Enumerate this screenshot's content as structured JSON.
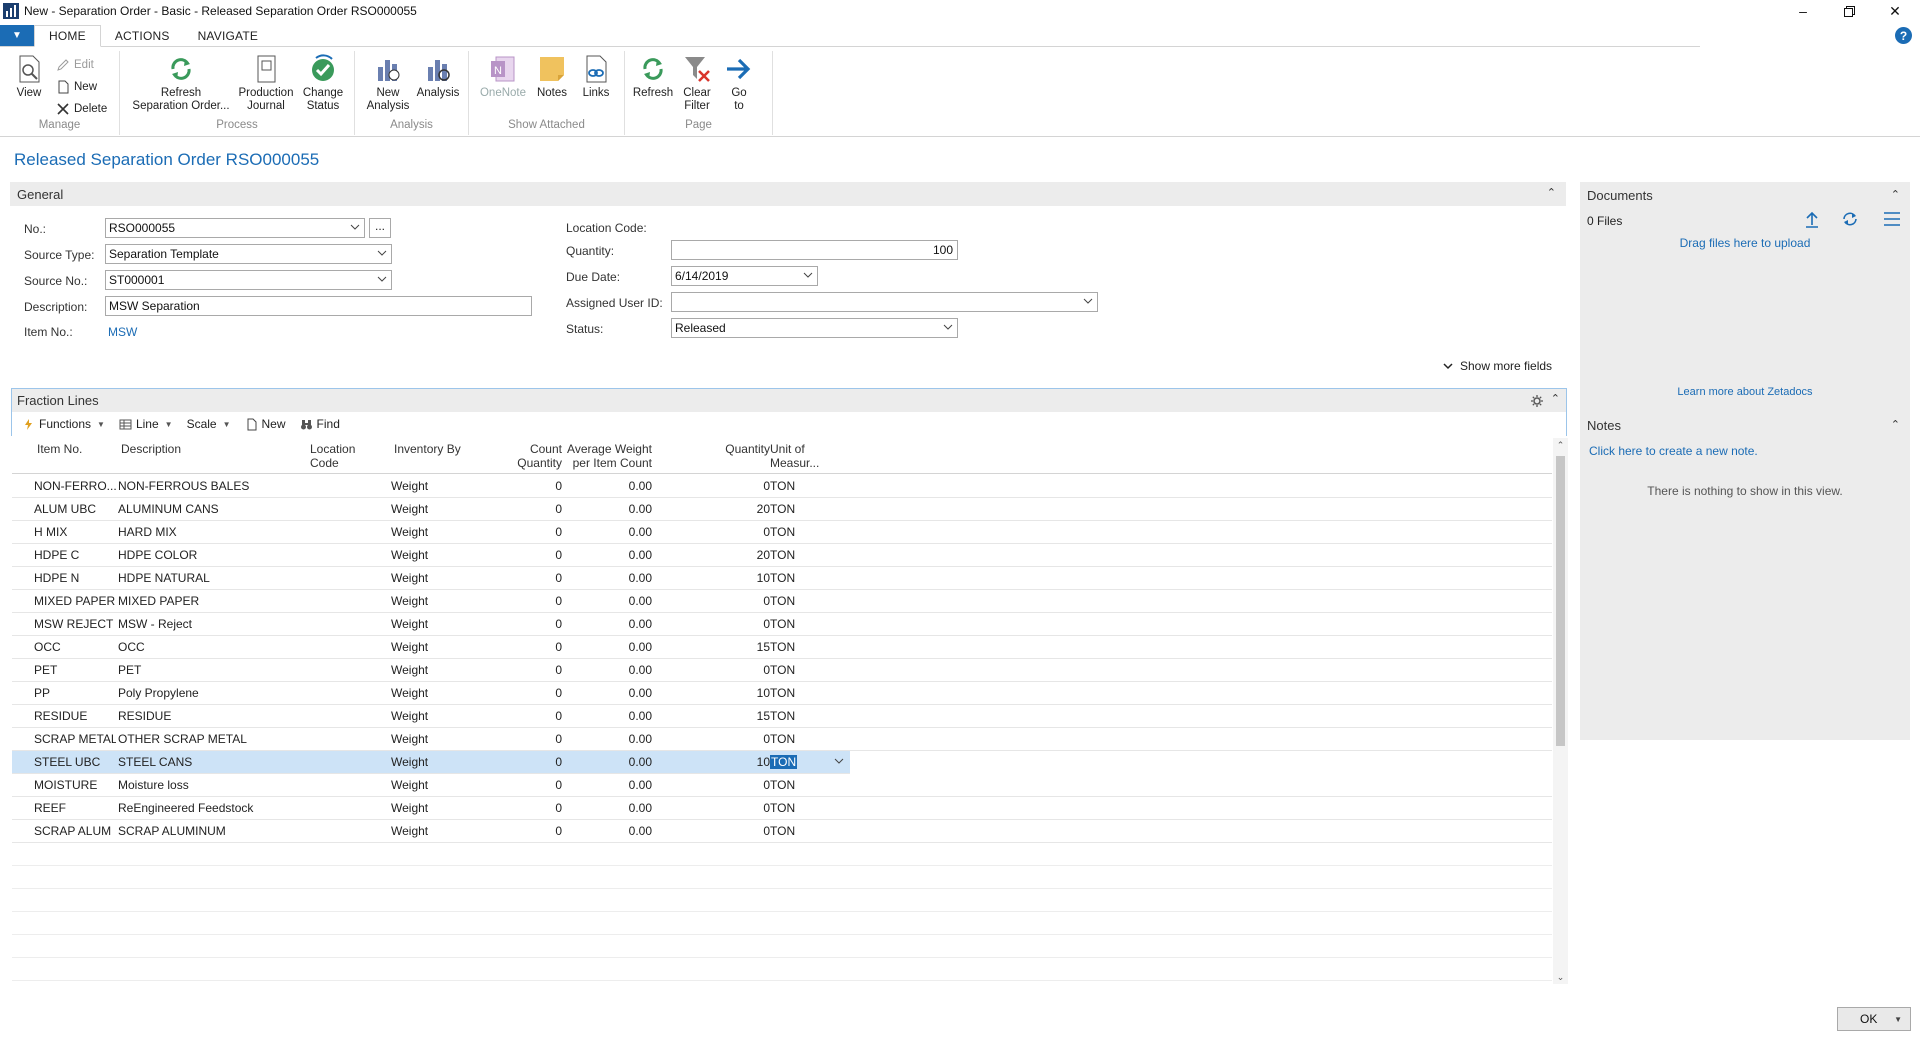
{
  "window": {
    "title": "New - Separation Order - Basic - Released Separation Order RSO000055"
  },
  "ribbon": {
    "tabs": [
      "HOME",
      "ACTIONS",
      "NAVIGATE"
    ],
    "groups": {
      "manage": {
        "label": "Manage",
        "view": "View",
        "edit": "Edit",
        "new": "New",
        "delete": "Delete"
      },
      "process": {
        "label": "Process",
        "refresh_line1": "Refresh",
        "refresh_line2": "Separation Order...",
        "production_line1": "Production",
        "production_line2": "Journal",
        "change_line1": "Change",
        "change_line2": "Status"
      },
      "analysis": {
        "label": "Analysis",
        "new_analysis_line1": "New",
        "new_analysis_line2": "Analysis",
        "analysis": "Analysis"
      },
      "show_attached": {
        "label": "Show Attached",
        "onenote": "OneNote",
        "notes": "Notes",
        "links": "Links"
      },
      "page": {
        "label": "Page",
        "refresh": "Refresh",
        "clear_line1": "Clear",
        "clear_line2": "Filter",
        "goto_line1": "Go",
        "goto_line2": "to"
      }
    }
  },
  "page_title": "Released Separation Order RSO000055",
  "general": {
    "header": "General",
    "no_label": "No.:",
    "no_value": "RSO000055",
    "assist": "...",
    "source_type_label": "Source Type:",
    "source_type_value": "Separation Template",
    "source_no_label": "Source No.:",
    "source_no_value": "ST000001",
    "description_label": "Description:",
    "description_value": "MSW Separation",
    "item_no_label": "Item No.:",
    "item_no_value": "MSW",
    "location_code_label": "Location Code:",
    "quantity_label": "Quantity:",
    "quantity_value": "100",
    "due_date_label": "Due Date:",
    "due_date_value": "6/14/2019",
    "assigned_user_label": "Assigned User ID:",
    "assigned_user_value": "",
    "status_label": "Status:",
    "status_value": "Released",
    "show_more": "Show more fields"
  },
  "lines": {
    "header": "Fraction Lines",
    "toolbar": {
      "functions": "Functions",
      "line": "Line",
      "scale": "Scale",
      "new": "New",
      "find": "Find"
    },
    "columns": {
      "item_no": "Item No.",
      "description": "Description",
      "location_line1": "Location",
      "location_line2": "Code",
      "inventory_by": "Inventory By",
      "count_line1": "Count",
      "count_line2": "Quantity",
      "avg_line1": "Average Weight",
      "avg_line2": "per Item Count",
      "quantity": "Quantity",
      "uom_line1": "Unit of",
      "uom_line2": "Measur..."
    },
    "rows": [
      {
        "item": "NON-FERRO...",
        "desc": "NON-FERROUS BALES",
        "inv": "Weight",
        "count": "0",
        "avg": "0.00",
        "qty": "0",
        "uom": "TON"
      },
      {
        "item": "ALUM UBC",
        "desc": "ALUMINUM CANS",
        "inv": "Weight",
        "count": "0",
        "avg": "0.00",
        "qty": "20",
        "uom": "TON"
      },
      {
        "item": "H MIX",
        "desc": "HARD MIX",
        "inv": "Weight",
        "count": "0",
        "avg": "0.00",
        "qty": "0",
        "uom": "TON"
      },
      {
        "item": "HDPE C",
        "desc": "HDPE COLOR",
        "inv": "Weight",
        "count": "0",
        "avg": "0.00",
        "qty": "20",
        "uom": "TON"
      },
      {
        "item": "HDPE N",
        "desc": "HDPE NATURAL",
        "inv": "Weight",
        "count": "0",
        "avg": "0.00",
        "qty": "10",
        "uom": "TON"
      },
      {
        "item": "MIXED PAPER",
        "desc": "MIXED PAPER",
        "inv": "Weight",
        "count": "0",
        "avg": "0.00",
        "qty": "0",
        "uom": "TON"
      },
      {
        "item": "MSW REJECT",
        "desc": "MSW - Reject",
        "inv": "Weight",
        "count": "0",
        "avg": "0.00",
        "qty": "0",
        "uom": "TON"
      },
      {
        "item": "OCC",
        "desc": "OCC",
        "inv": "Weight",
        "count": "0",
        "avg": "0.00",
        "qty": "15",
        "uom": "TON"
      },
      {
        "item": "PET",
        "desc": "PET",
        "inv": "Weight",
        "count": "0",
        "avg": "0.00",
        "qty": "0",
        "uom": "TON"
      },
      {
        "item": "PP",
        "desc": "Poly Propylene",
        "inv": "Weight",
        "count": "0",
        "avg": "0.00",
        "qty": "10",
        "uom": "TON"
      },
      {
        "item": "RESIDUE",
        "desc": "RESIDUE",
        "inv": "Weight",
        "count": "0",
        "avg": "0.00",
        "qty": "15",
        "uom": "TON"
      },
      {
        "item": "SCRAP METAL",
        "desc": "OTHER SCRAP METAL",
        "inv": "Weight",
        "count": "0",
        "avg": "0.00",
        "qty": "0",
        "uom": "TON"
      },
      {
        "item": "STEEL UBC",
        "desc": "STEEL CANS",
        "inv": "Weight",
        "count": "0",
        "avg": "0.00",
        "qty": "10",
        "uom": "TON"
      },
      {
        "item": "MOISTURE",
        "desc": "Moisture loss",
        "inv": "Weight",
        "count": "0",
        "avg": "0.00",
        "qty": "0",
        "uom": "TON"
      },
      {
        "item": "REEF",
        "desc": "ReEngineered Feedstock",
        "inv": "Weight",
        "count": "0",
        "avg": "0.00",
        "qty": "0",
        "uom": "TON"
      },
      {
        "item": "SCRAP ALUM",
        "desc": "SCRAP ALUMINUM",
        "inv": "Weight",
        "count": "0",
        "avg": "0.00",
        "qty": "0",
        "uom": "TON"
      }
    ]
  },
  "documents": {
    "header": "Documents",
    "files": "0 Files",
    "drag": "Drag files here to upload",
    "learn_more": "Learn more about Zetadocs"
  },
  "notes": {
    "header": "Notes",
    "create": "Click here to create a new note.",
    "empty": "There is nothing to show in this view."
  },
  "footer": {
    "ok": "OK"
  },
  "colors": {
    "accent": "#1b6cb5",
    "selected_row": "#cde3f7",
    "panel_bg": "#ececec"
  }
}
